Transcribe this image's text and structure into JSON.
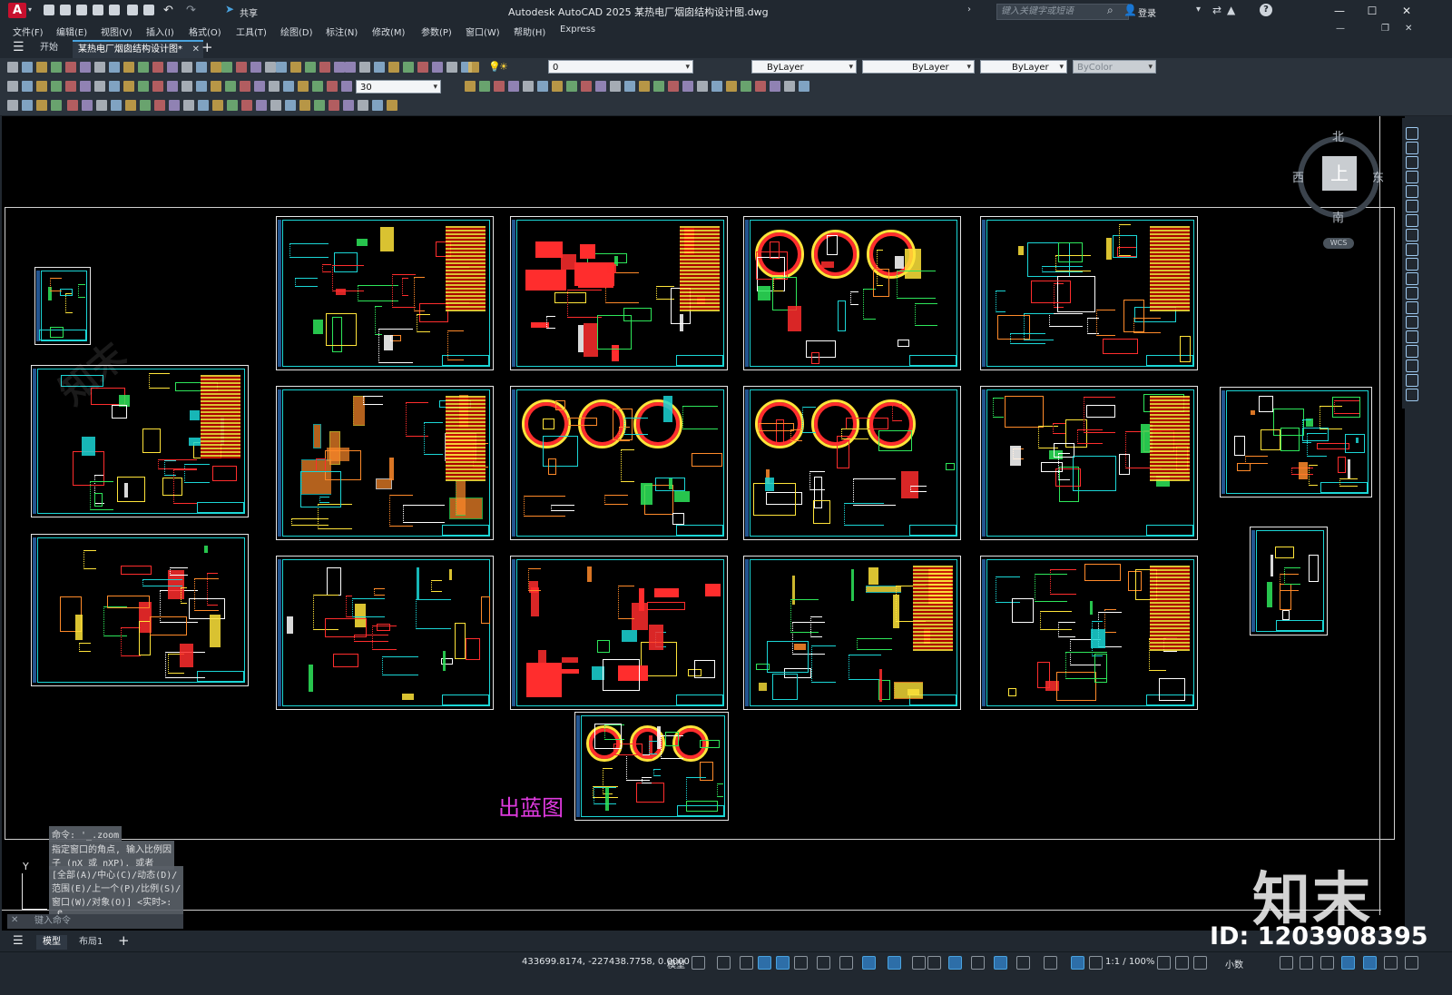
{
  "app": {
    "title": "Autodesk AutoCAD 2025    某热电厂烟囱结构设计图.dwg",
    "badge": "A",
    "share_label": "共享",
    "search_placeholder": "键入关键字或短语",
    "login_label": "登录",
    "help_icon": "?"
  },
  "menu": [
    "文件(F)",
    "编辑(E)",
    "视图(V)",
    "插入(I)",
    "格式(O)",
    "工具(T)",
    "绘图(D)",
    "标注(N)",
    "修改(M)",
    "参数(P)",
    "窗口(W)",
    "帮助(H)",
    "Express"
  ],
  "tabs": {
    "home": "开始",
    "document": "某热电厂烟囱结构设计图*",
    "close": "✕",
    "new": "+"
  },
  "toolbar": {
    "layer_value": "0",
    "color_value": "ByLayer",
    "linetype_value": "ByLayer",
    "lineweight_value": "ByLayer",
    "plotstyle_value": "ByColor",
    "dim_scale_value": "30"
  },
  "viewcube": {
    "north": "北",
    "south": "南",
    "east": "东",
    "west": "西",
    "face": "上",
    "wcs": "WCS"
  },
  "drawing": {
    "annotation": "出蓝图",
    "axis_y": "Y"
  },
  "command": {
    "history": [
      "命令: '_.zoom",
      "指定窗口的角点, 输入比例因\n子 (nX 或 nXP), 或者",
      "[全部(A)/中心(C)/动态(D)/\n范围(E)/上一个(P)/比例(S)/\n窗口(W)/对象(O)] <实时>:\n_e"
    ],
    "input_placeholder": "键入命令"
  },
  "layouts": {
    "model": "模型",
    "layout1": "布局1",
    "add": "+"
  },
  "status": {
    "coords": "433699.8174, -227438.7758, 0.0000",
    "mode": "模型",
    "scale": "1:1 / 100%",
    "units": "小数"
  },
  "watermark": {
    "logo": "知末",
    "id": "ID: 1203908395"
  }
}
